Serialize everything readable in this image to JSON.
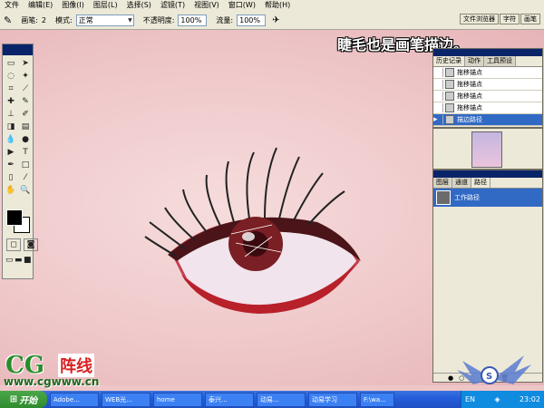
{
  "menubar": {
    "items": [
      "文件",
      "编辑(E)",
      "图像(I)",
      "图层(L)",
      "选择(S)",
      "滤镜(T)",
      "视图(V)",
      "窗口(W)",
      "帮助(H)"
    ]
  },
  "options": {
    "brush_label": "画笔:",
    "brush_size": "2",
    "mode_label": "模式:",
    "mode_value": "正常",
    "opacity_label": "不透明度:",
    "opacity_value": "100%",
    "flow_label": "流量:",
    "flow_value": "100%"
  },
  "palette_well": {
    "tabs": [
      "文件浏览器",
      "字符",
      "画笔"
    ]
  },
  "history_panel": {
    "tabs": [
      "历史记录",
      "动作",
      "工具预设"
    ],
    "rows": [
      "拖移锚点",
      "拖移锚点",
      "拖移锚点",
      "拖移锚点",
      "描边路径"
    ]
  },
  "paths_panel": {
    "tabs": [
      "图层",
      "通道",
      "路径"
    ],
    "row_label": "工作路径"
  },
  "caption": "睫毛也是画笔描边。",
  "watermark": {
    "logo_main": "CG",
    "logo_sub": "阵线",
    "logo_url": "www.cgwww.cn"
  },
  "taskbar": {
    "start": "开始",
    "tasks": [
      "Adobe...",
      "WEB光...",
      "home",
      "泰兴...",
      "动易...",
      "动易学习",
      "F:\\wa..."
    ],
    "tray_lang": "EN",
    "tray_time": "23:02"
  },
  "colors": {
    "skin": "#efc8ca",
    "iris": "#7a1f24",
    "selection": "#316ac5"
  }
}
